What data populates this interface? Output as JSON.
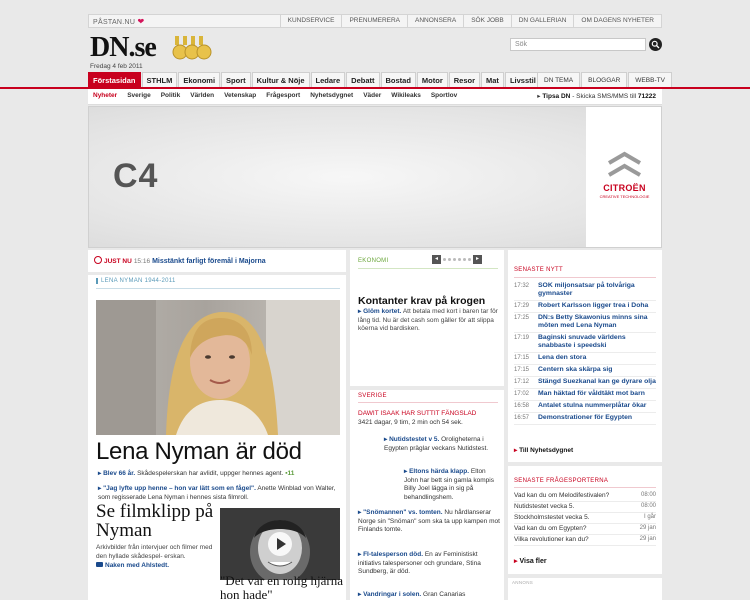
{
  "topbar": {
    "pastan": "PÅSTAN.NU",
    "links": [
      "KUNDSERVICE",
      "PRENUMERERA",
      "ANNONSERA",
      "SÖK JOBB",
      "DN GALLERIAN",
      "OM DAGENS NYHETER"
    ]
  },
  "header": {
    "logo": "DN.se",
    "date": "Fredag 4 feb 2011",
    "search_placeholder": "Sök"
  },
  "main_nav": [
    "Förstasidan",
    "STHLM",
    "Ekonomi",
    "Sport",
    "Kultur & Nöje",
    "Ledare",
    "Debatt",
    "Bostad",
    "Motor",
    "Resor",
    "Mat",
    "Livsstil"
  ],
  "right_nav": [
    "DN TEMA",
    "BLOGGAR",
    "WEBB-TV"
  ],
  "sub_nav": [
    "Nyheter",
    "Sverige",
    "Politik",
    "Världen",
    "Vetenskap",
    "Frågesport",
    "Nyhetsdygnet",
    "Väder",
    "Wikileaks",
    "Sportlov"
  ],
  "tips": {
    "label": "Tipsa DN",
    "text": "- Skicka SMS/MMS till",
    "number": "71222"
  },
  "banner": {
    "model": "C4",
    "brand": "CITROËN",
    "tagline": "CREATIVE TECHNOLOGIE"
  },
  "just_nu": {
    "label": "JUST NU",
    "time": "15:16",
    "headline": "Misstänkt farligt föremål i Majorna"
  },
  "lead": {
    "kicker": "LENA NYMAN 1944-2011",
    "headline": "Lena Nyman är död",
    "bullet1_link": "Blev 66 år.",
    "bullet1_text": "Skådespelerskan har avlidit, uppger hennes agent.",
    "bullet1_comments": "11",
    "bullet2_link": "\"Jag lyfte upp henne – hon var lätt som en fågel\".",
    "bullet2_text": "Anette Winblad von Walter, som regisserade Lena Nyman i hennes sista filmroll.",
    "sub_headline": "Se filmklipp på Nyman",
    "sub_text": "Arkivbilder från intervjuer och filmer med den hyllade skådespel- erskan.",
    "sub_link": "Naken med Ahlstedt.",
    "quote": "\"Det var en rolig hjärna hon hade\""
  },
  "ekonomi": {
    "label": "EKONOMI",
    "pager_prev": "◂",
    "pager_next": "▸",
    "title": "Kontanter krav på krogen",
    "link": "Glöm kortet.",
    "text": "Att betala med kort i baren tar för lång tid. Nu är det cash som gäller för att slippa köerna vid bardisken."
  },
  "sverige": {
    "label": "SVERIGE",
    "kicker": "DAWIT ISAAK HAR SUTTIT FÄNGSLAD",
    "count": "3421 dagar, 9 tim, 2 min och 54 sek.",
    "items": [
      {
        "link": "Nutidstestet v 5.",
        "text": "Oroligheterna i Egypten präglar veckans Nutidstest."
      },
      {
        "link": "Eltons härda klapp.",
        "text": "Elton John har bett sin gamla kompis Billy Joel lägga in sig på behandlingshem."
      },
      {
        "link": "\"Snömannen\" vs. tomten.",
        "text": "Nu hårdlanserar Norge sin \"Snöman\" som ska ta upp kampen mot Finlands tomte."
      },
      {
        "link": "FI-talesperson död.",
        "text": "En av Feministiskt initiativs talespersoner och grundare, Stina Sundberg, är död."
      },
      {
        "link": "Vandringar i solen.",
        "text": "Gran Canarias"
      }
    ]
  },
  "senaste_nytt": {
    "label": "SENASTE NYTT",
    "items": [
      {
        "time": "17:32",
        "headline": "SOK miljonsatsar på tolvåriga gymnaster"
      },
      {
        "time": "17:29",
        "headline": "Robert Karlsson ligger trea i Doha"
      },
      {
        "time": "17:25",
        "headline": "DN:s Betty Skawonius minns sina möten med Lena Nyman"
      },
      {
        "time": "17:19",
        "headline": "Baginski snuvade världens snabbaste i speedski"
      },
      {
        "time": "17:15",
        "headline": "Lena den stora"
      },
      {
        "time": "17:15",
        "headline": "Centern ska skärpa sig"
      },
      {
        "time": "17:12",
        "headline": "Stängd Suezkanal kan ge dyrare olja"
      },
      {
        "time": "17:02",
        "headline": "Man häktad för våldtäkt mot barn"
      },
      {
        "time": "16:58",
        "headline": "Antalet stulna nummerplåtar ökar"
      },
      {
        "time": "16:57",
        "headline": "Demonstrationer för Egypten"
      }
    ],
    "more": "Till Nyhetsdygnet"
  },
  "fragesport": {
    "label": "SENASTE FRÅGESPORTERNA",
    "items": [
      {
        "title": "Vad kan du om Melodifestivalen?",
        "date": "08:00"
      },
      {
        "title": "Nutidstestet vecka 5.",
        "date": "08:00"
      },
      {
        "title": "Stockholmstestet vecka 5.",
        "date": "I går"
      },
      {
        "title": "Vad kan du om Egypten?",
        "date": "29 jan"
      },
      {
        "title": "Vilka revolutioner kan du?",
        "date": "29 jan"
      }
    ],
    "more": "Visa fler"
  },
  "annons_label": "ANNONS"
}
